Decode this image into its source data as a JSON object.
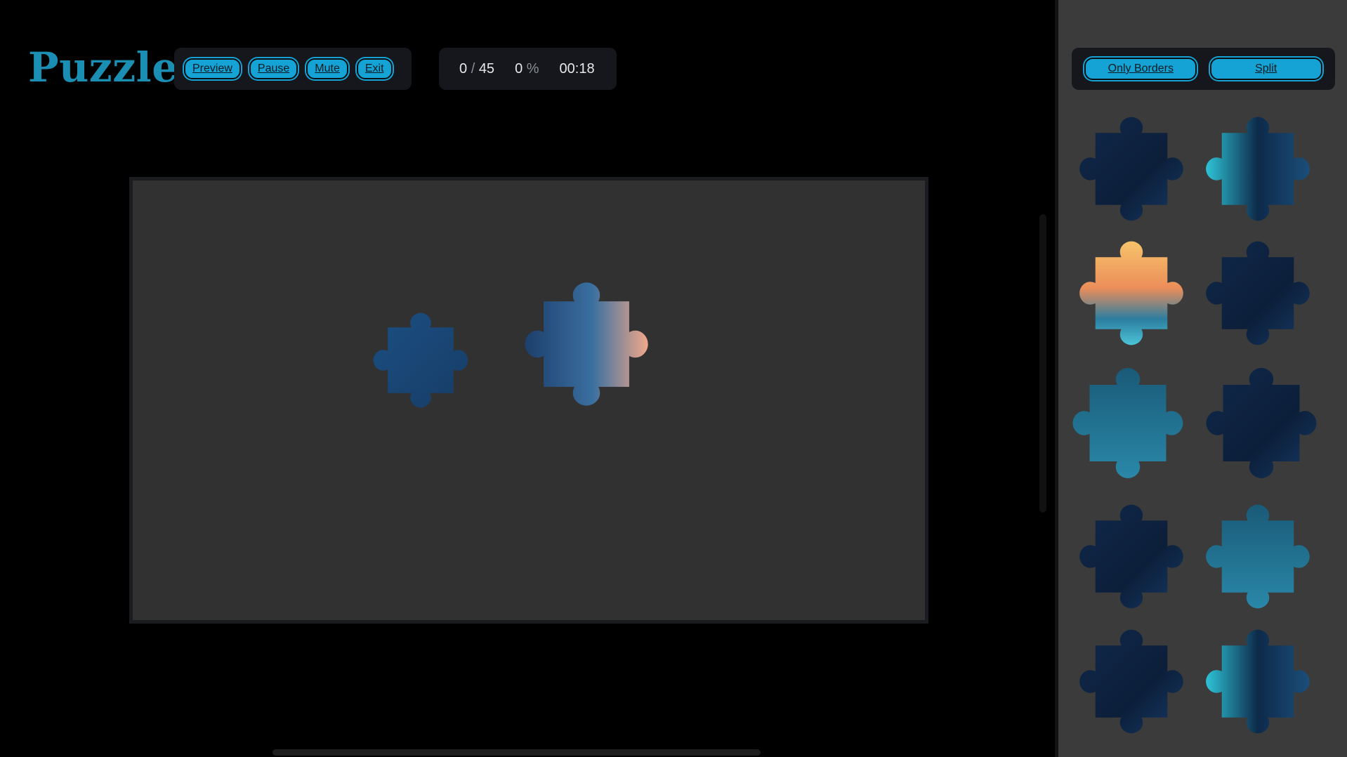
{
  "app": {
    "title": "Puzzle"
  },
  "toolbar": {
    "preview_label": "Preview",
    "pause_label": "Pause",
    "mute_label": "Mute",
    "exit_label": "Exit"
  },
  "stats": {
    "placed": "0",
    "separator": "/",
    "total": "45",
    "percent": "0",
    "percent_sign": "%",
    "timer": "00:18"
  },
  "sidebar": {
    "only_borders_label": "Only Borders",
    "split_label": "Split"
  },
  "colors": {
    "accent": "#14a3d4",
    "logo": "#1a8fb3",
    "board": "#313131",
    "sidebar": "#3b3b3b",
    "piece_dark": "#0d2240",
    "piece_teal": "#1f6e8c",
    "piece_cyan": "#35c7d8",
    "piece_sunset": "#f2b35e"
  }
}
